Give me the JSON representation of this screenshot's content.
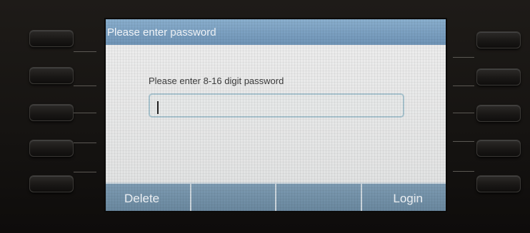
{
  "dialog": {
    "title": "Please enter password",
    "prompt": "Please enter 8-16 digit password",
    "password_value": ""
  },
  "softkeys": [
    {
      "label": "Delete"
    },
    {
      "label": ""
    },
    {
      "label": ""
    },
    {
      "label": "Login"
    }
  ],
  "colors": {
    "title_bar": "#7ea3c3",
    "softkey_bar": "#7593aa",
    "content_bg": "#e9eaea",
    "input_border": "#a9c4cf"
  }
}
